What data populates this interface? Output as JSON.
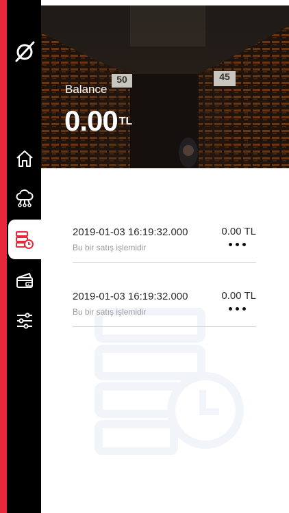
{
  "colors": {
    "accent": "#e8283a",
    "sidebar": "#000000"
  },
  "hero": {
    "balance_label": "Balance",
    "balance_amount": "0.00",
    "balance_currency": "TL",
    "signs": [
      "50",
      "45"
    ]
  },
  "sidebar": {
    "items": [
      {
        "icon": "home-icon",
        "active": false
      },
      {
        "icon": "cloud-network-icon",
        "active": false
      },
      {
        "icon": "transactions-history-icon",
        "active": true
      },
      {
        "icon": "wallet-cards-icon",
        "active": false
      },
      {
        "icon": "settings-sliders-icon",
        "active": false
      }
    ]
  },
  "transactions": [
    {
      "date": "2019-01-03 16:19:32.000",
      "amount": "0.00 TL",
      "description": "Bu bir satış işlemidir"
    },
    {
      "date": "2019-01-03 16:19:32.000",
      "amount": "0.00 TL",
      "description": "Bu bir satış işlemidir"
    }
  ]
}
